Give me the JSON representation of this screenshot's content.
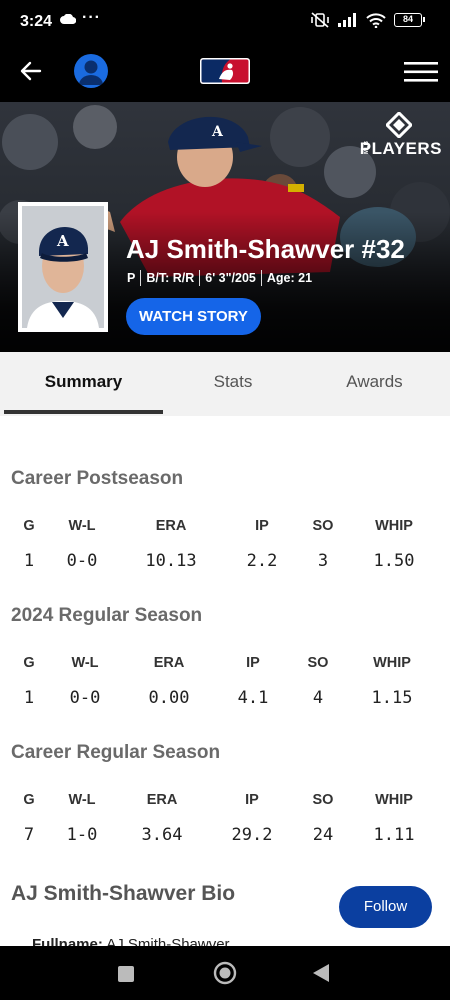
{
  "status_bar": {
    "time": "3:24",
    "dots": "···",
    "battery": "84"
  },
  "header": {
    "back_icon": "arrow-left-icon",
    "profile_icon": "user-circle-icon",
    "logo": "mlb-logo",
    "menu_icon": "hamburger-menu-icon"
  },
  "hero": {
    "players_logo_text": "PLAYERS",
    "players_logo_small": "MLB",
    "name": "AJ Smith-Shawver #32",
    "meta": [
      "P",
      "B/T: R/R",
      "6' 3\"/205",
      "Age: 21"
    ],
    "watch_story_label": "WATCH STORY"
  },
  "tabs": [
    "Summary",
    "Stats",
    "Awards"
  ],
  "active_tab": "Summary",
  "stat_sections": [
    {
      "title": "Career Postseason",
      "headers": [
        "G",
        "W-L",
        "ERA",
        "IP",
        "SO",
        "WHIP"
      ],
      "values": [
        "1",
        "0-0",
        "10.13",
        "2.2",
        "3",
        "1.50"
      ]
    },
    {
      "title": "2024 Regular Season",
      "headers": [
        "G",
        "W-L",
        "ERA",
        "IP",
        "SO",
        "WHIP"
      ],
      "values": [
        "1",
        "0-0",
        "0.00",
        "4.1",
        "4",
        "1.15"
      ]
    },
    {
      "title": "Career Regular Season",
      "headers": [
        "G",
        "W-L",
        "ERA",
        "IP",
        "SO",
        "WHIP"
      ],
      "values": [
        "7",
        "1-0",
        "3.64",
        "29.2",
        "24",
        "1.11"
      ]
    }
  ],
  "bio": {
    "title": "AJ Smith-Shawver Bio",
    "follow_label": "Follow",
    "fullname_label": "Fullname:",
    "fullname_value": "AJ Smith-Shawver"
  },
  "colors": {
    "accent_blue": "#1565e8",
    "follow_blue": "#0b3fa0",
    "braves_red": "#c8102e",
    "braves_navy": "#13274f"
  }
}
